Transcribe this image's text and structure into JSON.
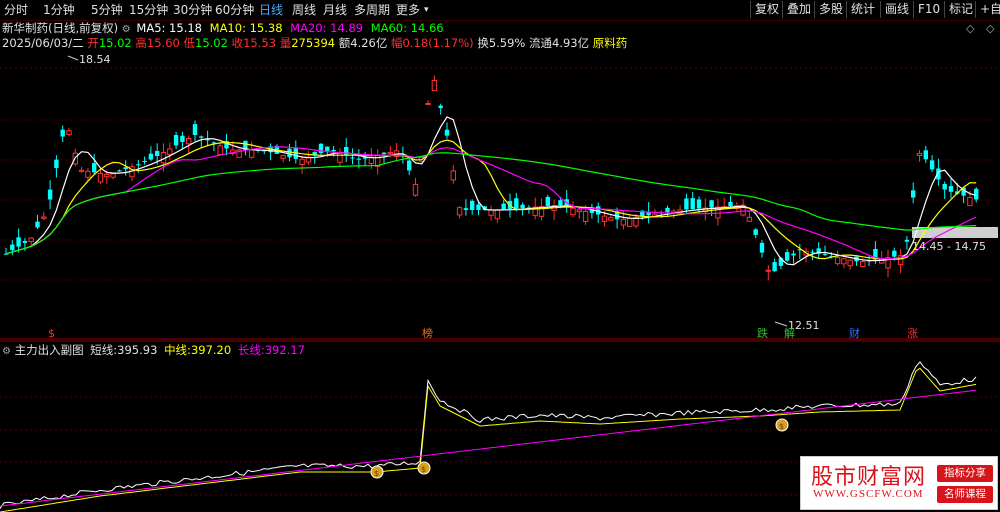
{
  "toolbar": {
    "periods": [
      "分时",
      "1分钟",
      "5分钟",
      "15分钟",
      "30分钟",
      "60分钟",
      "日线",
      "周线",
      "月线",
      "多周期",
      "更多"
    ],
    "active_period": "日线",
    "right_buttons": [
      "复权",
      "叠加",
      "多股",
      "统计",
      "画线",
      "F10",
      "标记",
      "+自"
    ]
  },
  "main_chart": {
    "title": "新华制药(日线,前复权)",
    "ma_legend": [
      {
        "label": "MA5: 15.18",
        "color": "#ffffff"
      },
      {
        "label": "MA10: 15.38",
        "color": "#ffff00"
      },
      {
        "label": "MA20: 14.89",
        "color": "#ff00ff"
      },
      {
        "label": "MA60: 14.66",
        "color": "#00ff00"
      }
    ],
    "date": "2025/06/03/二",
    "quote": {
      "open_label": "开",
      "open": "15.02",
      "high_label": "高",
      "high": "15.60",
      "low_label": "低",
      "low": "15.02",
      "close_label": "收",
      "close": "15.53",
      "volume_label": "量",
      "volume": "275394",
      "amount_label": "额",
      "amount": "4.26亿",
      "change_label": "幅",
      "change": "0.18(1.17%)",
      "turnover_label": "换",
      "turnover": "5.59%",
      "float_label": "流通",
      "float": "4.93亿",
      "sector": "原料药"
    },
    "price_high_marker": "18.54",
    "price_low_marker": "12.51",
    "range_box_label": "14.45 - 14.75",
    "event_markers": [
      {
        "label": "$",
        "color": "#ff3030"
      },
      {
        "label": "榜",
        "color": "#e07020"
      },
      {
        "label": "跌",
        "color": "#30c030"
      },
      {
        "label": "解",
        "color": "#30c030"
      },
      {
        "label": "财",
        "color": "#3070ff"
      },
      {
        "label": "涨",
        "color": "#ff3030"
      }
    ]
  },
  "sub_chart": {
    "title": "主力出入副图",
    "short_label": "短线:",
    "short_value": "395.93",
    "mid_label": "中线:",
    "mid_value": "397.20",
    "long_label": "长线:",
    "long_value": "392.17"
  },
  "watermark": {
    "brand": "股市财富网",
    "url": "WWW.GSCFW.COM",
    "tag1": "指标分享",
    "tag2": "名师课程"
  },
  "colors": {
    "up": "#ff3030",
    "down": "#00ffff",
    "ma5": "#ffffff",
    "ma10": "#ffff00",
    "ma20": "#ff00ff",
    "ma60": "#00ff00"
  }
}
